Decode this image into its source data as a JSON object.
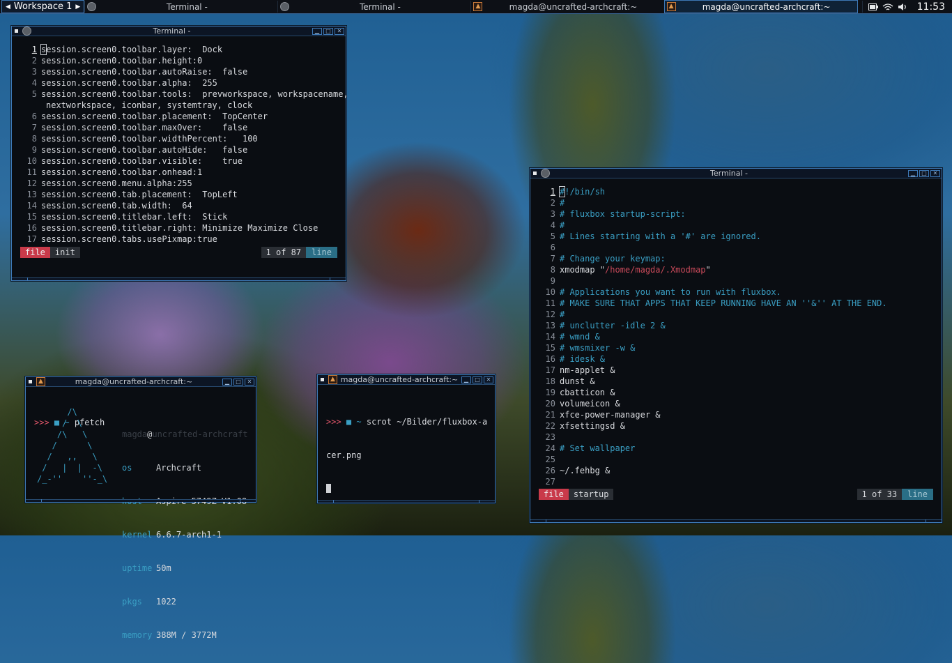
{
  "toolbar": {
    "workspace": "Workspace 1",
    "tasks": [
      {
        "label": "Terminal -",
        "icon": "terminal-icon"
      },
      {
        "label": "Terminal -",
        "icon": "terminal-icon"
      },
      {
        "label": "magda@uncrafted-archcraft:~",
        "icon": "archcraft-icon"
      },
      {
        "label": "magda@uncrafted-archcraft:~",
        "icon": "archcraft-icon"
      }
    ],
    "tray_icons": [
      "battery-icon",
      "wifi-icon",
      "volume-icon"
    ],
    "clock": "11:53"
  },
  "win1": {
    "title": "Terminal -",
    "lines": [
      {
        "n": "1",
        "t": "session.screen0.toolbar.layer:  Dock"
      },
      {
        "n": "2",
        "t": "session.screen0.toolbar.height:0"
      },
      {
        "n": "3",
        "t": "session.screen0.toolbar.autoRaise:  false"
      },
      {
        "n": "4",
        "t": "session.screen0.toolbar.alpha:  255"
      },
      {
        "n": "5",
        "t": "session.screen0.toolbar.tools:  prevworkspace, workspacename,"
      },
      {
        "n": "",
        "t": "nextworkspace, iconbar, systemtray, clock"
      },
      {
        "n": "6",
        "t": "session.screen0.toolbar.placement:  TopCenter"
      },
      {
        "n": "7",
        "t": "session.screen0.toolbar.maxOver:    false"
      },
      {
        "n": "8",
        "t": "session.screen0.toolbar.widthPercent:   100"
      },
      {
        "n": "9",
        "t": "session.screen0.toolbar.autoHide:   false"
      },
      {
        "n": "10",
        "t": "session.screen0.toolbar.visible:    true"
      },
      {
        "n": "11",
        "t": "session.screen0.toolbar.onhead:1"
      },
      {
        "n": "12",
        "t": "session.screen0.menu.alpha:255"
      },
      {
        "n": "13",
        "t": "session.screen0.tab.placement:  TopLeft"
      },
      {
        "n": "14",
        "t": "session.screen0.tab.width:  64"
      },
      {
        "n": "15",
        "t": "session.screen0.titlebar.left:  Stick"
      },
      {
        "n": "16",
        "t": "session.screen0.titlebar.right: Minimize Maximize Close"
      },
      {
        "n": "17",
        "t": "session.screen0.tabs.usePixmap:true"
      }
    ],
    "status": {
      "mode": "file",
      "name": "init",
      "pos": "1 of 87",
      "unit": "line"
    }
  },
  "win2": {
    "title": "Terminal -",
    "lines": [
      {
        "n": "1",
        "t": "#!/bin/sh",
        "c": "cmt"
      },
      {
        "n": "2",
        "t": "#",
        "c": "cmt"
      },
      {
        "n": "3",
        "t": "# fluxbox startup-script:",
        "c": "cmt"
      },
      {
        "n": "4",
        "t": "#",
        "c": "cmt"
      },
      {
        "n": "5",
        "t": "# Lines starting with a '#' are ignored.",
        "c": "cmt"
      },
      {
        "n": "6",
        "t": "",
        "c": ""
      },
      {
        "n": "7",
        "t": "# Change your keymap:",
        "c": "cmt"
      },
      {
        "n": "8",
        "t": "xmodmap \"/home/magda/.Xmodmap\"",
        "c": "mix"
      },
      {
        "n": "9",
        "t": "",
        "c": ""
      },
      {
        "n": "10",
        "t": "# Applications you want to run with fluxbox.",
        "c": "cmt"
      },
      {
        "n": "11",
        "t": "# MAKE SURE THAT APPS THAT KEEP RUNNING HAVE AN ''&'' AT THE END.",
        "c": "cmt"
      },
      {
        "n": "12",
        "t": "#",
        "c": "cmt"
      },
      {
        "n": "13",
        "t": "# unclutter -idle 2 &",
        "c": "cmt"
      },
      {
        "n": "14",
        "t": "# wmnd &",
        "c": "cmt"
      },
      {
        "n": "15",
        "t": "# wmsmixer -w &",
        "c": "cmt"
      },
      {
        "n": "16",
        "t": "# idesk &",
        "c": "cmt"
      },
      {
        "n": "17",
        "t": "nm-applet &",
        "c": ""
      },
      {
        "n": "18",
        "t": "dunst &",
        "c": ""
      },
      {
        "n": "19",
        "t": "cbatticon &",
        "c": ""
      },
      {
        "n": "20",
        "t": "volumeicon &",
        "c": ""
      },
      {
        "n": "21",
        "t": "xfce-power-manager &",
        "c": ""
      },
      {
        "n": "22",
        "t": "xfsettingsd &",
        "c": ""
      },
      {
        "n": "23",
        "t": "",
        "c": ""
      },
      {
        "n": "24",
        "t": "# Set wallpaper",
        "c": "cmt"
      },
      {
        "n": "25",
        "t": "",
        "c": ""
      },
      {
        "n": "26",
        "t": "~/.fehbg &",
        "c": ""
      },
      {
        "n": "27",
        "t": "",
        "c": ""
      }
    ],
    "xmodmap_cmd": "xmodmap ",
    "xmodmap_q1": "\"",
    "xmodmap_path": "/home/magda/.Xmodmap",
    "xmodmap_q2": "\"",
    "status": {
      "mode": "file",
      "name": "startup",
      "pos": "1 of 33",
      "unit": "line"
    }
  },
  "win3": {
    "title": "magda@uncrafted-archcraft:~",
    "prompt": ">>>",
    "cwd": "~",
    "command": "pfetch",
    "logo": [
      "      /\\",
      "     /  \\",
      "    /\\   \\",
      "   /      \\",
      "  /   ,,   \\",
      " /   |  |  -\\",
      "/_-''    ''-_\\"
    ],
    "user": "magda",
    "at": "@",
    "host_name": "uncrafted-archcraft",
    "info": [
      {
        "k": "os",
        "v": "Archcraft"
      },
      {
        "k": "host",
        "v": "Aspire 5749Z V1.08"
      },
      {
        "k": "kernel",
        "v": "6.6.7-arch1-1"
      },
      {
        "k": "uptime",
        "v": "50m"
      },
      {
        "k": "pkgs",
        "v": "1022"
      },
      {
        "k": "memory",
        "v": "388M / 3772M"
      }
    ]
  },
  "win4": {
    "title": "magda@uncrafted-archcraft:~",
    "prompt": ">>>",
    "cwd": "~",
    "command_l1": "scrot ~/Bilder/fluxbox-a",
    "command_l2": "cer.png"
  }
}
